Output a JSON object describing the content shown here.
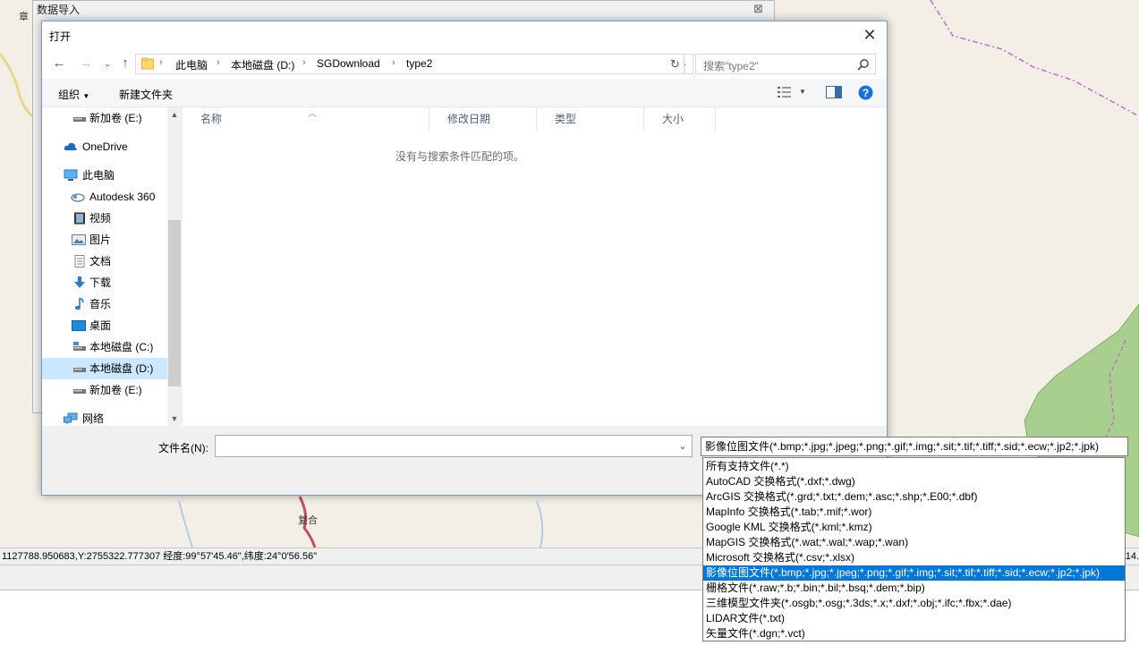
{
  "background_app": {
    "import_window_title": "数据导入",
    "map_labels": {
      "left_edge": "章",
      "village": "复合"
    },
    "status_left": "1127788.950683,Y:2755322.777307   经度:99°57'45.46\",纬度:24°0'56.56\"",
    "status_right": "14."
  },
  "dialog": {
    "title": "打开",
    "breadcrumbs": [
      "此电脑",
      "本地磁盘 (D:)",
      "SGDownload",
      "type2"
    ],
    "search_placeholder": "搜索\"type2\"",
    "toolbar": {
      "organize": "组织",
      "new_folder": "新建文件夹"
    },
    "nav_items": [
      {
        "label": "新加卷 (E:)",
        "icon": "drive-icon"
      },
      {
        "label": "OneDrive",
        "icon": "cloud-icon"
      },
      {
        "label": "此电脑",
        "icon": "computer-icon"
      },
      {
        "label": "Autodesk 360",
        "icon": "autodesk-icon"
      },
      {
        "label": "视频",
        "icon": "video-icon"
      },
      {
        "label": "图片",
        "icon": "picture-icon"
      },
      {
        "label": "文档",
        "icon": "document-icon"
      },
      {
        "label": "下载",
        "icon": "download-icon"
      },
      {
        "label": "音乐",
        "icon": "music-icon"
      },
      {
        "label": "桌面",
        "icon": "desktop-icon"
      },
      {
        "label": "本地磁盘 (C:)",
        "icon": "drive-icon"
      },
      {
        "label": "本地磁盘 (D:)",
        "icon": "drive-icon",
        "selected": true
      },
      {
        "label": "新加卷 (E:)",
        "icon": "drive-icon"
      },
      {
        "label": "网络",
        "icon": "network-icon"
      }
    ],
    "columns": [
      "名称",
      "修改日期",
      "类型",
      "大小"
    ],
    "empty_message": "没有与搜索条件匹配的项。",
    "filename_label": "文件名(N):",
    "filename_value": "",
    "selected_filetype": "影像位图文件(*.bmp;*.jpg;*.jpeg;*.png;*.gif;*.img;*.sit;*.tif;*.tiff;*.sid;*.ecw;*.jp2;*.jpk)",
    "filetype_options": [
      "所有支持文件(*.*)",
      "AutoCAD 交换格式(*.dxf;*.dwg)",
      "ArcGIS 交换格式(*.grd;*.txt;*.dem;*.asc;*.shp;*.E00;*.dbf)",
      "MapInfo 交换格式(*.tab;*.mif;*.wor)",
      "Google KML 交换格式(*.kml;*.kmz)",
      "MapGIS 交换格式(*.wat;*.wal;*.wap;*.wan)",
      "Microsoft 交换格式(*.csv;*.xlsx)",
      "影像位图文件(*.bmp;*.jpg;*.jpeg;*.png;*.gif;*.img;*.sit;*.tif;*.tiff;*.sid;*.ecw;*.jp2;*.jpk)",
      "栅格文件(*.raw;*.b;*.bin;*.bil;*.bsq;*.dem;*.bip)",
      "三维模型文件夹(*.osgb;*.osg;*.3ds;*.x;*.dxf;*.obj;*.ifc;*.fbx;*.dae)",
      "LIDAR文件(*.txt)",
      "矢量文件(*.dgn;*.vct)"
    ],
    "selected_option_index": 7
  },
  "colors": {
    "accent": "#0078d7",
    "nav_selected": "#cce8ff",
    "map_green": "#a9cf8e",
    "map_road": "#c84b66"
  }
}
